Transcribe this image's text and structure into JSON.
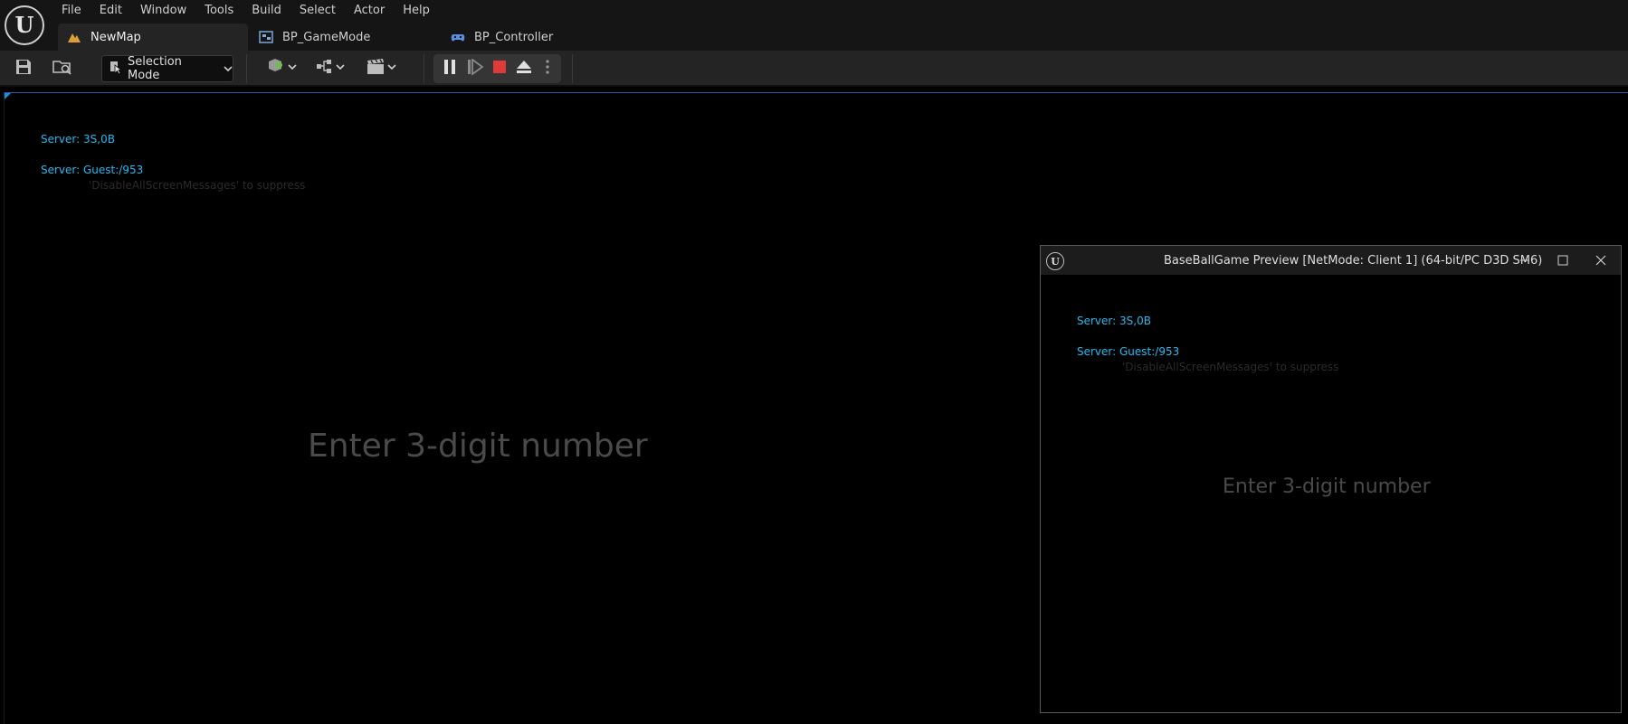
{
  "app": {
    "menu": [
      "File",
      "Edit",
      "Window",
      "Tools",
      "Build",
      "Select",
      "Actor",
      "Help"
    ],
    "tabs": [
      {
        "label": "NewMap",
        "icon": "map-icon",
        "active": true
      },
      {
        "label": "BP_GameMode",
        "icon": "blueprint-icon",
        "active": false
      },
      {
        "label": "BP_Controller",
        "icon": "controller-icon",
        "active": false
      }
    ]
  },
  "toolbar": {
    "selection_mode": "Selection Mode"
  },
  "viewport": {
    "line1": "Server: 3S,0B",
    "line2": "Server: Guest:/953",
    "hint": "'DisableAllScreenMessages' to suppress",
    "prompt": "Enter 3-digit number"
  },
  "client_window": {
    "title": "BaseBallGame Preview [NetMode: Client 1]  (64-bit/PC D3D SM6)",
    "line1": "Server: 3S,0B",
    "line2": "Server: Guest:/953",
    "hint": "'DisableAllScreenMessages' to suppress",
    "prompt": "Enter 3-digit number"
  },
  "colors": {
    "debug_text": "#27b8f0",
    "stop_button": "#e03a3a",
    "accent": "#1c8fe0"
  }
}
